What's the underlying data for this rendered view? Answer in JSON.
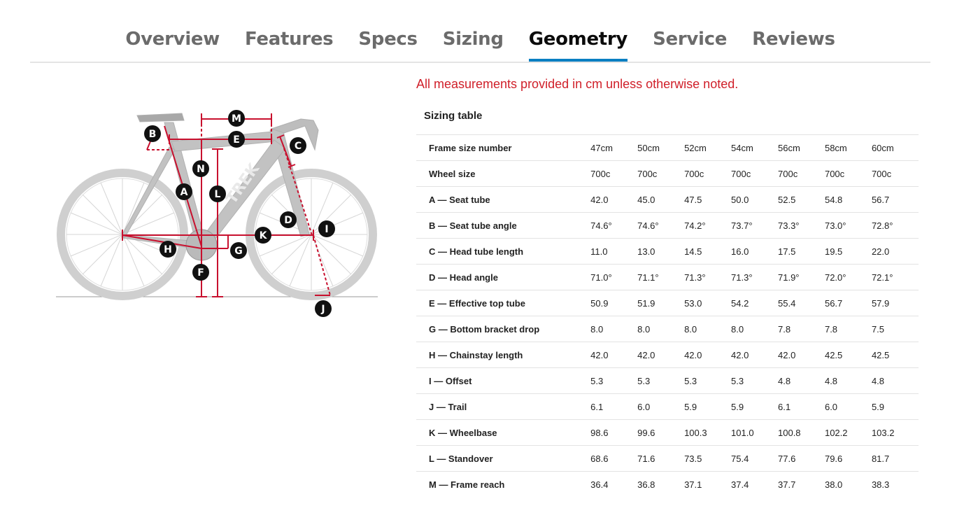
{
  "tabs": [
    {
      "label": "Overview",
      "active": false
    },
    {
      "label": "Features",
      "active": false
    },
    {
      "label": "Specs",
      "active": false
    },
    {
      "label": "Sizing",
      "active": false
    },
    {
      "label": "Geometry",
      "active": true
    },
    {
      "label": "Service",
      "active": false
    },
    {
      "label": "Reviews",
      "active": false
    }
  ],
  "note": "All measurements provided in cm unless otherwise noted.",
  "table": {
    "title": "Sizing table",
    "rows": [
      {
        "label": "Frame size number",
        "values": [
          "47cm",
          "50cm",
          "52cm",
          "54cm",
          "56cm",
          "58cm",
          "60cm"
        ]
      },
      {
        "label": "Wheel size",
        "values": [
          "700c",
          "700c",
          "700c",
          "700c",
          "700c",
          "700c",
          "700c"
        ]
      },
      {
        "label": "A — Seat tube",
        "values": [
          "42.0",
          "45.0",
          "47.5",
          "50.0",
          "52.5",
          "54.8",
          "56.7"
        ]
      },
      {
        "label": "B — Seat tube angle",
        "values": [
          "74.6°",
          "74.6°",
          "74.2°",
          "73.7°",
          "73.3°",
          "73.0°",
          "72.8°"
        ]
      },
      {
        "label": "C — Head tube length",
        "values": [
          "11.0",
          "13.0",
          "14.5",
          "16.0",
          "17.5",
          "19.5",
          "22.0"
        ]
      },
      {
        "label": "D — Head angle",
        "values": [
          "71.0°",
          "71.1°",
          "71.3°",
          "71.3°",
          "71.9°",
          "72.0°",
          "72.1°"
        ]
      },
      {
        "label": "E — Effective top tube",
        "values": [
          "50.9",
          "51.9",
          "53.0",
          "54.2",
          "55.4",
          "56.7",
          "57.9"
        ]
      },
      {
        "label": "G — Bottom bracket drop",
        "values": [
          "8.0",
          "8.0",
          "8.0",
          "8.0",
          "7.8",
          "7.8",
          "7.5"
        ]
      },
      {
        "label": "H — Chainstay length",
        "values": [
          "42.0",
          "42.0",
          "42.0",
          "42.0",
          "42.0",
          "42.5",
          "42.5"
        ]
      },
      {
        "label": "I — Offset",
        "values": [
          "5.3",
          "5.3",
          "5.3",
          "5.3",
          "4.8",
          "4.8",
          "4.8"
        ]
      },
      {
        "label": "J — Trail",
        "values": [
          "6.1",
          "6.0",
          "5.9",
          "5.9",
          "6.1",
          "6.0",
          "5.9"
        ]
      },
      {
        "label": "K — Wheelbase",
        "values": [
          "98.6",
          "99.6",
          "100.3",
          "101.0",
          "100.8",
          "102.2",
          "103.2"
        ]
      },
      {
        "label": "L — Standover",
        "values": [
          "68.6",
          "71.6",
          "73.5",
          "75.4",
          "77.6",
          "79.6",
          "81.7"
        ]
      },
      {
        "label": "M — Frame reach",
        "values": [
          "36.4",
          "36.8",
          "37.1",
          "37.4",
          "37.7",
          "38.0",
          "38.3"
        ]
      }
    ]
  },
  "diagram": {
    "brand": "TREK",
    "markers": [
      {
        "letter": "M"
      },
      {
        "letter": "E"
      },
      {
        "letter": "B"
      },
      {
        "letter": "C"
      },
      {
        "letter": "N"
      },
      {
        "letter": "L"
      },
      {
        "letter": "A"
      },
      {
        "letter": "D"
      },
      {
        "letter": "I"
      },
      {
        "letter": "K"
      },
      {
        "letter": "H"
      },
      {
        "letter": "G"
      },
      {
        "letter": "F"
      },
      {
        "letter": "J"
      }
    ]
  },
  "colors": {
    "accent": "#0a7fc2",
    "note": "#d0202a",
    "dimension": "#c8102e"
  }
}
